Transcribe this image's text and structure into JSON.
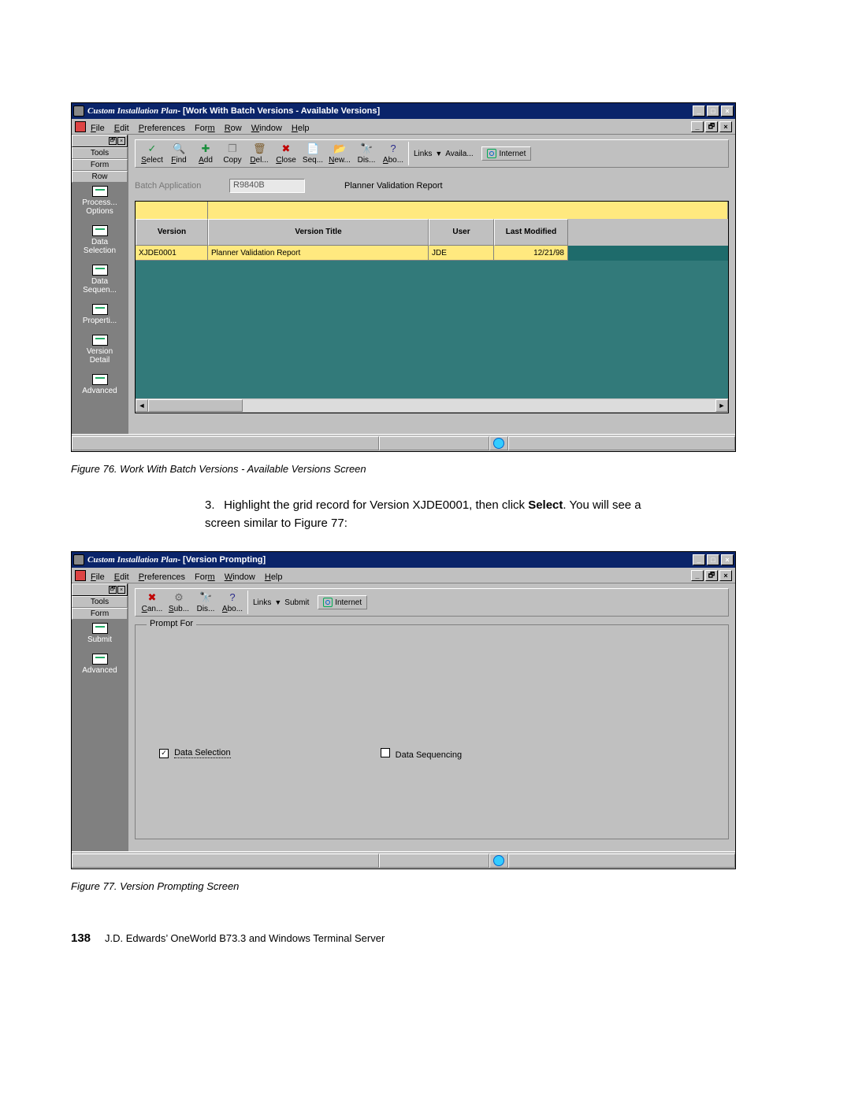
{
  "win1": {
    "title_app": "Custom Installation Plan",
    "title_sub": " - [Work With Batch Versions - Available Versions]",
    "winctrls": {
      "min": "_",
      "max": "□",
      "close": "×"
    },
    "mdictrls": {
      "min": "_",
      "rest": "🗗",
      "close": "×"
    },
    "menus": [
      "File",
      "Edit",
      "Preferences",
      "Form",
      "Row",
      "Window",
      "Help"
    ],
    "menu_underline_idx": [
      0,
      0,
      0,
      3,
      0,
      0,
      0
    ],
    "sidebar": {
      "tabs": [
        "Tools",
        "Form",
        "Row"
      ],
      "items": [
        {
          "label": "Process... Options"
        },
        {
          "label": "Data Selection"
        },
        {
          "label": "Data Sequen..."
        },
        {
          "label": "Properti..."
        },
        {
          "label": "Version Detail"
        },
        {
          "label": "Advanced"
        }
      ]
    },
    "toolbar": {
      "buttons": [
        {
          "name": "select",
          "label": "Select",
          "u": 0,
          "iconcolor": "#1a8f3c",
          "glyph": "✓"
        },
        {
          "name": "find",
          "label": "Find",
          "u": 0,
          "iconcolor": "#2b5aa8",
          "glyph": "🔍"
        },
        {
          "name": "add",
          "label": "Add",
          "u": 0,
          "iconcolor": "#1a8f3c",
          "glyph": "✚"
        },
        {
          "name": "copy",
          "label": "Copy",
          "u": -1,
          "iconcolor": "#7a7a7a",
          "glyph": "❐"
        },
        {
          "name": "delete",
          "label": "Del...",
          "u": 0,
          "iconcolor": "#7a5a2a",
          "glyph": "🗑"
        },
        {
          "name": "close",
          "label": "Close",
          "u": 0,
          "iconcolor": "#c00000",
          "glyph": "✖"
        },
        {
          "name": "seq",
          "label": "Seq...",
          "u": -1,
          "iconcolor": "#4a9a2a",
          "glyph": "📄"
        },
        {
          "name": "new",
          "label": "New...",
          "u": 0,
          "iconcolor": "#b78a2a",
          "glyph": "📂"
        },
        {
          "name": "dis",
          "label": "Dis...",
          "u": -1,
          "iconcolor": "#8a4a2a",
          "glyph": "🔭"
        },
        {
          "name": "about",
          "label": "Abo...",
          "u": 0,
          "iconcolor": "#2a2a8a",
          "glyph": "?"
        }
      ],
      "links_label": "Links",
      "links_dropdown": "Availa...",
      "internet": "Internet"
    },
    "fieldrow": {
      "label": "Batch Application",
      "value": "R9840B",
      "desc": "Planner Validation Report"
    },
    "grid": {
      "headers": [
        "Version",
        "Version Title",
        "User",
        "Last Modified"
      ],
      "row": {
        "version": "XJDE0001",
        "title": "Planner Validation Report",
        "user": "JDE",
        "lastmod": "12/21/98"
      }
    }
  },
  "caption1": "Figure 76.  Work With Batch Versions - Available Versions Screen",
  "body_step": {
    "num": "3.",
    "text_before": "Highlight the grid record for Version XJDE0001, then click ",
    "bold": "Select",
    "text_after": ". You will see a screen similar to Figure 77:"
  },
  "win2": {
    "title_app": "Custom Installation Plan",
    "title_sub": " - [Version Prompting]",
    "menus": [
      "File",
      "Edit",
      "Preferences",
      "Form",
      "Window",
      "Help"
    ],
    "menu_underline_idx": [
      0,
      0,
      0,
      3,
      0,
      0
    ],
    "sidebar": {
      "tabs": [
        "Tools",
        "Form"
      ],
      "items": [
        {
          "label": "Submit"
        },
        {
          "label": "Advanced"
        }
      ]
    },
    "toolbar": {
      "buttons": [
        {
          "name": "cancel",
          "label": "Can...",
          "u": 0,
          "iconcolor": "#c00000",
          "glyph": "✖"
        },
        {
          "name": "submit",
          "label": "Sub...",
          "u": 0,
          "iconcolor": "#6a6a6a",
          "glyph": "⚙"
        },
        {
          "name": "dis",
          "label": "Dis...",
          "u": -1,
          "iconcolor": "#8a4a2a",
          "glyph": "🔭"
        },
        {
          "name": "about",
          "label": "Abo...",
          "u": 0,
          "iconcolor": "#2a2a8a",
          "glyph": "?"
        }
      ],
      "links_label": "Links",
      "links_dropdown": "Submit",
      "internet": "Internet"
    },
    "group": {
      "legend": "Prompt For",
      "data_selection": "Data Selection",
      "data_selection_checked": true,
      "data_sequencing": "Data Sequencing",
      "data_sequencing_checked": false
    }
  },
  "caption2": "Figure 77.  Version Prompting Screen",
  "footer": {
    "page": "138",
    "text": "J.D. Edwards’ OneWorld B73.3 and Windows Terminal Server"
  }
}
